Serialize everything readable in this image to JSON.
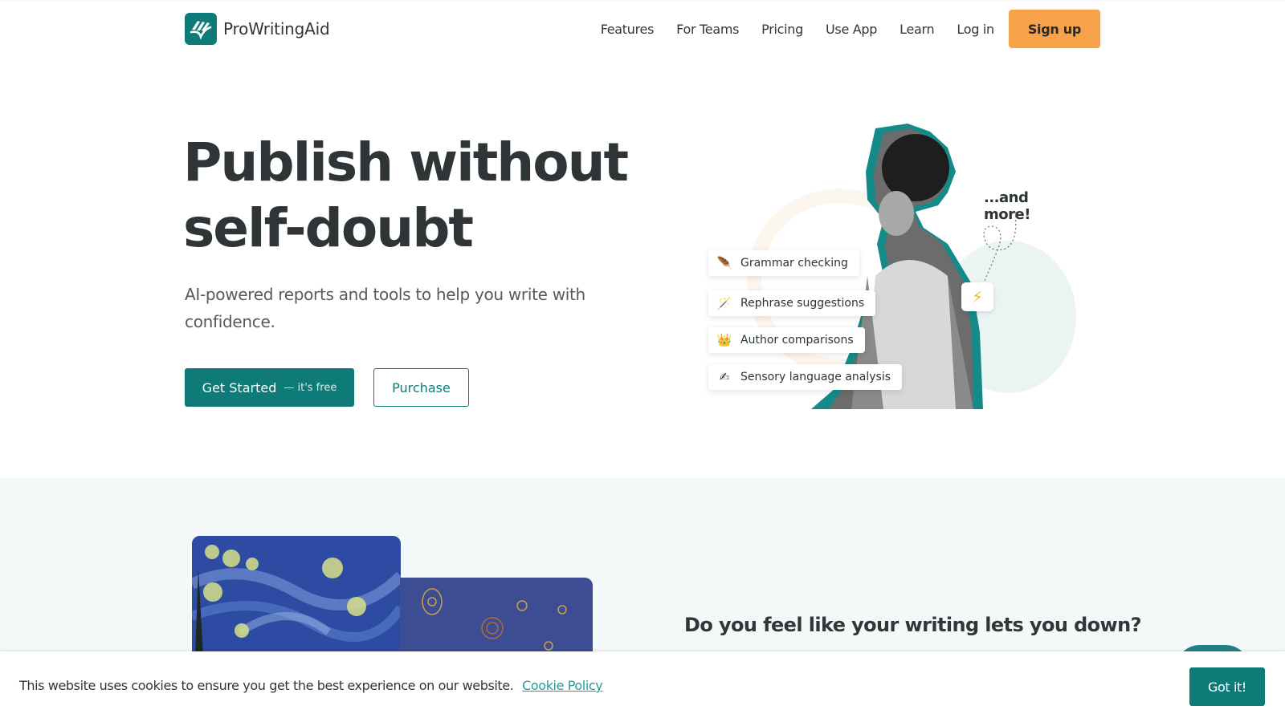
{
  "header": {
    "brand": "ProWritingAid",
    "logo_icon": "open-book-check-icon",
    "nav": [
      {
        "label": "Features"
      },
      {
        "label": "For Teams"
      },
      {
        "label": "Pricing"
      },
      {
        "label": "Use App"
      },
      {
        "label": "Learn"
      },
      {
        "label": "Log in"
      }
    ],
    "signup_label": "Sign up"
  },
  "hero": {
    "title": "Publish without self-doubt",
    "subtitle": "AI-powered reports and tools to help you write with confidence.",
    "get_started_label": "Get Started",
    "get_started_note": "— it's free",
    "purchase_label": "Purchase",
    "illustration": {
      "more_text": "...and more!",
      "features": [
        {
          "icon": "feather-icon",
          "glyph": "🪶",
          "label": "Grammar checking"
        },
        {
          "icon": "magic-wand-icon",
          "glyph": "🪄",
          "label": "Rephrase suggestions"
        },
        {
          "icon": "crown-icon",
          "glyph": "👑",
          "label": "Author comparisons"
        },
        {
          "icon": "writing-hand-icon",
          "glyph": "✍",
          "label": "Sensory language analysis"
        }
      ],
      "bolt_glyph": "⚡"
    }
  },
  "section2": {
    "question": "Do you feel like your writing lets you down?"
  },
  "cookie": {
    "message": "This website uses cookies to ensure you get the best experience on our website.",
    "link_label": "Cookie Policy",
    "button_label": "Got it!"
  },
  "colors": {
    "brand_teal": "#0e7b78",
    "signup_orange": "#f7a34b",
    "section_bg": "#f3f9f9",
    "link_teal": "#2a9a9a"
  }
}
